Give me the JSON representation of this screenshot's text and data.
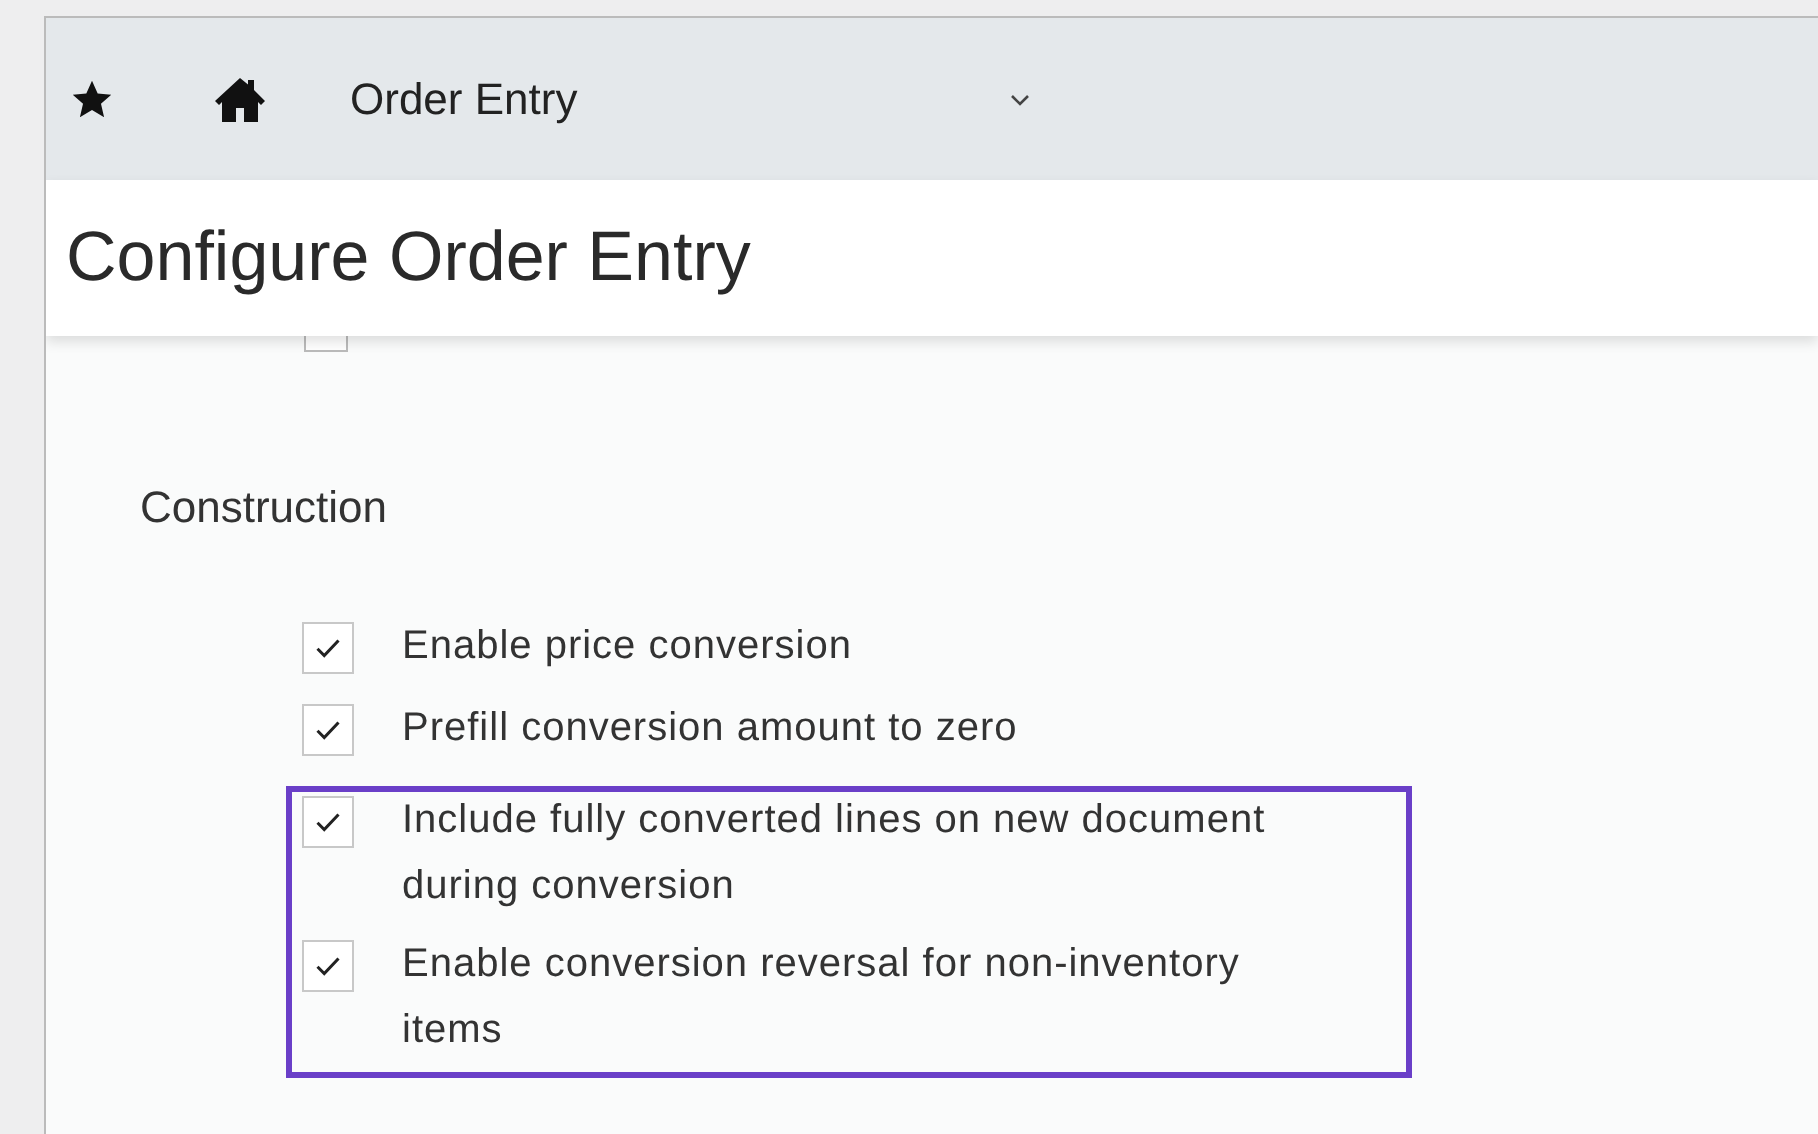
{
  "nav_bar": {
    "title": "Order Entry"
  },
  "page": {
    "title": "Configure Order Entry"
  },
  "hidden_option": {
    "checked": false
  },
  "section": {
    "title": "Construction"
  },
  "options": [
    {
      "label": "Enable price conversion",
      "checked": true,
      "highlighted": false
    },
    {
      "label": "Prefill conversion amount to zero",
      "checked": true,
      "highlighted": false
    },
    {
      "label": "Include fully converted lines on new document during conversion",
      "checked": true,
      "highlighted": true
    },
    {
      "label": "Enable conversion reversal for non-inventory items",
      "checked": true,
      "highlighted": true
    }
  ]
}
